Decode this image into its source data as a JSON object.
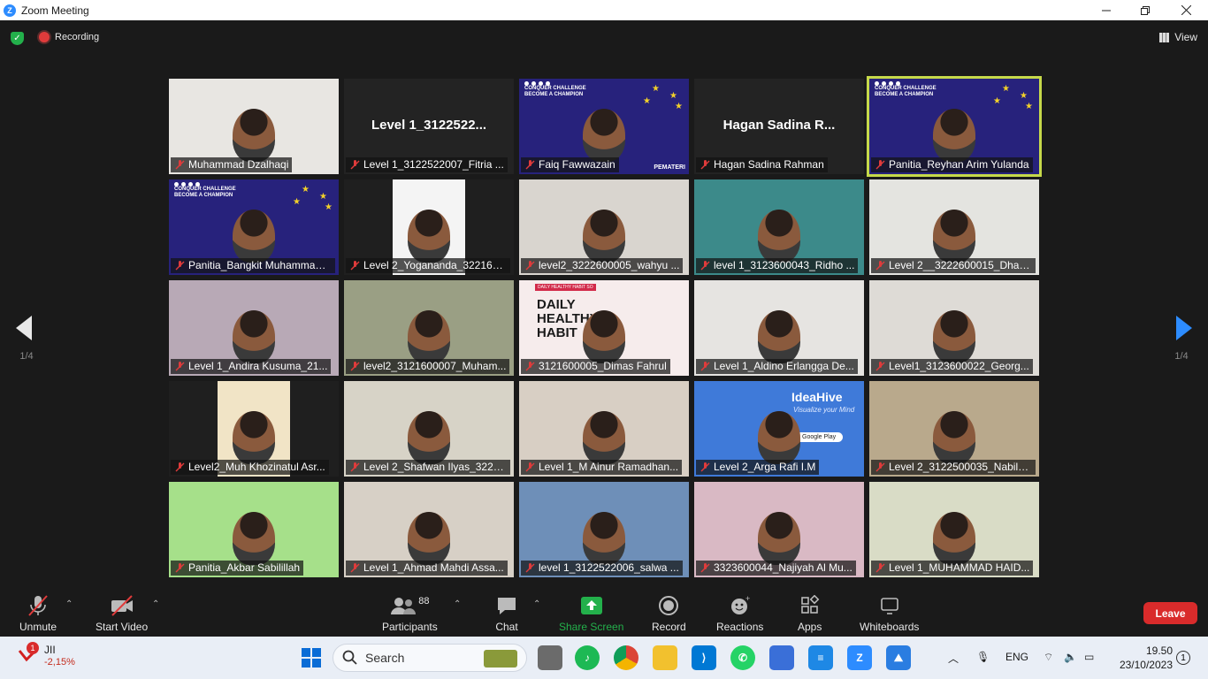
{
  "window": {
    "title": "Zoom Meeting"
  },
  "top": {
    "recording_label": "Recording",
    "view_label": "View"
  },
  "gallery": {
    "page_left": "1/4",
    "page_right": "1/4",
    "tiles": [
      {
        "label": "Muhammad Dzalhaqi",
        "big": "",
        "bg": "#e8e6e2"
      },
      {
        "label": "Level 1_3122522007_Fitria ...",
        "big": "Level 1_3122522...",
        "bg": "#232323"
      },
      {
        "label": "Faiq Fawwazain",
        "big": "",
        "bg": "slide"
      },
      {
        "label": "Hagan Sadina Rahman",
        "big": "Hagan Sadina R...",
        "bg": "#232323"
      },
      {
        "label": "Panitia_Reyhan Arim Yulanda",
        "big": "",
        "bg": "slide"
      },
      {
        "label": "Panitia_Bangkit Muhammad ...",
        "big": "",
        "bg": "slide"
      },
      {
        "label": "Level 2_Yogananda_322160...",
        "big": "",
        "bg": "#1f1f1f"
      },
      {
        "label": "level2_3222600005_wahyu ...",
        "big": "",
        "bg": "#d9d5cf"
      },
      {
        "label": "level 1_3123600043_Ridho ...",
        "big": "",
        "bg": "#3c8a8a"
      },
      {
        "label": "Level 2__3222600015_Dhan...",
        "big": "",
        "bg": "#e4e4e0"
      },
      {
        "label": "Level 1_Andira Kusuma_21...",
        "big": "",
        "bg": "#b8a9b6"
      },
      {
        "label": "level2_3121600007_Muham...",
        "big": "",
        "bg": "#9a9f84"
      },
      {
        "label": "3121600005_Dimas Fahrul",
        "big": "",
        "bg": "#f6ecec"
      },
      {
        "label": "Level 1_Aldino Erlangga De...",
        "big": "",
        "bg": "#e6e4e1"
      },
      {
        "label": "Level1_3123600022_Georg...",
        "big": "",
        "bg": "#dedbd6"
      },
      {
        "label": "Level2_Muh Khozinatul Asr...",
        "big": "",
        "bg": "#1f1f1f"
      },
      {
        "label": "Level 2_Shafwan Ilyas_3222...",
        "big": "",
        "bg": "#d7d3c7"
      },
      {
        "label": "Level 1_M Ainur Ramadhan...",
        "big": "",
        "bg": "#d8cfc4"
      },
      {
        "label": "Level 2_Arga Rafi I.M",
        "big": "",
        "bg": "#3f7ad9"
      },
      {
        "label": "Level 2_3122500035_Nabila...",
        "big": "",
        "bg": "#b9a98c"
      },
      {
        "label": "Panitia_Akbar Sabilillah",
        "big": "",
        "bg": "#a6e08a"
      },
      {
        "label": "Level 1_Ahmad Mahdi Assa...",
        "big": "",
        "bg": "#d7d0c6"
      },
      {
        "label": "level 1_3122522006_salwa ...",
        "big": "",
        "bg": "#6e8fb8"
      },
      {
        "label": "3323600044_Najiyah Al Mu...",
        "big": "",
        "bg": "#d9b9c4"
      },
      {
        "label": "Level 1_MUHAMMAD HAID...",
        "big": "",
        "bg": "#d9dcc6"
      }
    ],
    "slide_text": "CONQUER CHALLENGE BECOME A CHAMPION",
    "slide_tag": "PEMATERI",
    "healthy_text": "DAILY HEALTHY HABIT",
    "healthy_banner": "DAILY HEALTHY HABIT SO",
    "ideahive_title": "IdeaHive",
    "ideahive_sub": "Visualize your Mind",
    "ideahive_store": "Google Play"
  },
  "toolbar": {
    "unmute": "Unmute",
    "start_video": "Start Video",
    "participants": "Participants",
    "participants_count": "88",
    "chat": "Chat",
    "share_screen": "Share Screen",
    "record": "Record",
    "reactions": "Reactions",
    "apps": "Apps",
    "whiteboards": "Whiteboards",
    "leave": "Leave"
  },
  "taskbar": {
    "stock_badge": "1",
    "stock_name": "JII",
    "stock_change": "-2,15%",
    "search_label": "Search",
    "lang": "ENG",
    "time": "19.50",
    "date": "23/10/2023",
    "notif": "1"
  },
  "colors": {
    "share_green": "#23b04b",
    "leave_red": "#d92b2b",
    "active_outline": "#c6d94a",
    "arrow_blue": "#2d8cff"
  }
}
